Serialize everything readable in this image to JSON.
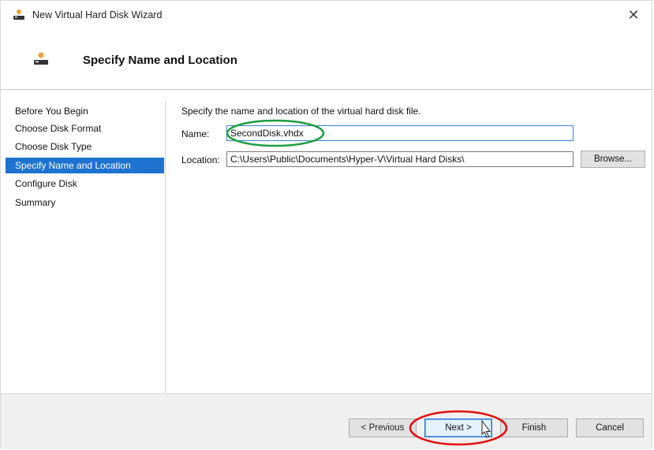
{
  "window": {
    "title": "New Virtual Hard Disk Wizard",
    "close_glyph": "✕"
  },
  "header": {
    "title": "Specify Name and Location"
  },
  "sidebar": {
    "items": [
      {
        "label": "Before You Begin",
        "active": false
      },
      {
        "label": "Choose Disk Format",
        "active": false
      },
      {
        "label": "Choose Disk Type",
        "active": false
      },
      {
        "label": "Specify Name and Location",
        "active": true
      },
      {
        "label": "Configure Disk",
        "active": false
      },
      {
        "label": "Summary",
        "active": false
      }
    ]
  },
  "main": {
    "instruction": "Specify the name and location of the virtual hard disk file.",
    "name_label": "Name:",
    "name_value": "SecondDisk.vhdx",
    "location_label": "Location:",
    "location_value": "C:\\Users\\Public\\Documents\\Hyper-V\\Virtual Hard Disks\\",
    "browse_label": "Browse..."
  },
  "footer": {
    "previous_label": "< Previous",
    "next_label": "Next >",
    "finish_label": "Finish",
    "cancel_label": "Cancel"
  },
  "colors": {
    "selection": "#1e73d1",
    "annotation_green": "#1a9e3f",
    "annotation_red": "#e01010"
  }
}
